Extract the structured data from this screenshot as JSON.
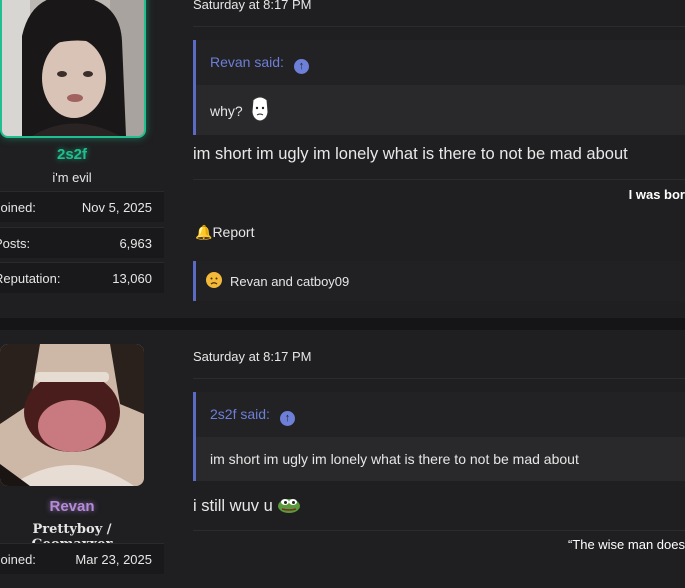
{
  "colors": {
    "accent_green": "#1fc08e",
    "quote_blue": "#6d7fd6",
    "revan_purple": "#b58ad8"
  },
  "posts": [
    {
      "date": "Saturday at 8:17 PM",
      "user": {
        "name": "2s2f",
        "title": "i'm evil",
        "stats": [
          {
            "label": "Joined:",
            "value": "Nov 5, 2025"
          },
          {
            "label": "Posts:",
            "value": "6,963"
          },
          {
            "label": "Reputation:",
            "value": "13,060"
          }
        ]
      },
      "quote": {
        "author": "Revan said:",
        "text": "why?"
      },
      "message": "im short im ugly im lonely what is there to not be mad about",
      "signature": "I was bor",
      "report_label": "Report",
      "reactions": "Revan and catboy09"
    },
    {
      "date": "Saturday at 8:17 PM",
      "user": {
        "name": "Revan",
        "title": "Prettyboy / Geomaxxer",
        "stats": [
          {
            "label": "Joined:",
            "value": "Mar 23, 2025"
          }
        ]
      },
      "quote": {
        "author": "2s2f said:",
        "text": "im short im ugly im lonely what is there to not be mad about"
      },
      "message": "i still wuv u",
      "signature": "“The wise man does"
    }
  ]
}
